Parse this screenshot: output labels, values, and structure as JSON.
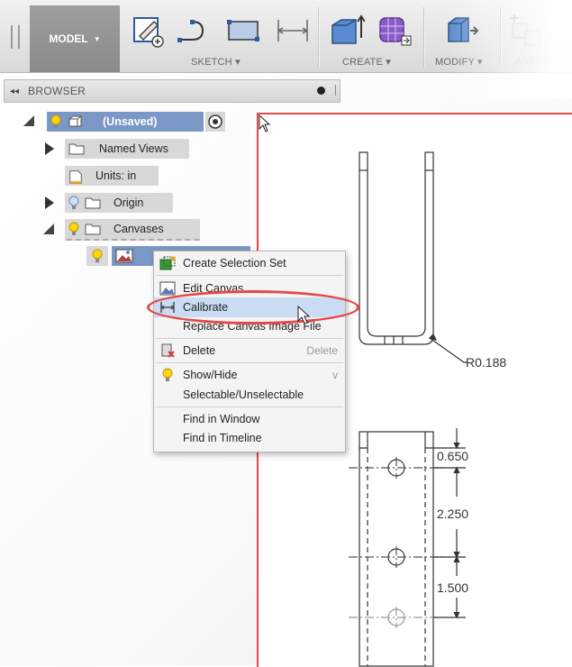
{
  "toolbar": {
    "model_label": "MODEL",
    "groups": [
      {
        "label": "SKETCH"
      },
      {
        "label": "CREATE"
      },
      {
        "label": "MODIFY"
      },
      {
        "label": "ASSEMB"
      }
    ]
  },
  "browser": {
    "title": "BROWSER",
    "collapse_glyph": "◂◂"
  },
  "tree": {
    "root_label": "(Unsaved)",
    "named_views": "Named Views",
    "units": "Units: in",
    "origin": "Origin",
    "canvases": "Canvases"
  },
  "context_menu": {
    "items": [
      {
        "label": "Create Selection Set",
        "icon": "selection-set-icon"
      },
      {
        "label": "Edit Canvas",
        "icon": "canvas-icon"
      },
      {
        "label": "Calibrate",
        "icon": "calibrate-icon"
      },
      {
        "label": "Replace Canvas Image File"
      },
      {
        "label": "Delete",
        "shortcut": "Delete",
        "icon": "delete-icon"
      },
      {
        "label": "Show/Hide",
        "shortcut": "v",
        "icon": "bulb-icon"
      },
      {
        "label": "Selectable/Unselectable"
      },
      {
        "label": "Find in Window"
      },
      {
        "label": "Find in Timeline"
      }
    ]
  },
  "drawing": {
    "radius_label": "R0.188",
    "dim1": "0.650",
    "dim2": "2.250",
    "dim3": "1.500"
  },
  "colors": {
    "highlight_ring": "#e84747",
    "canvas_border": "#e24a4a",
    "selection": "#7a97c5",
    "menu_highlight": "#c9dcf3"
  }
}
